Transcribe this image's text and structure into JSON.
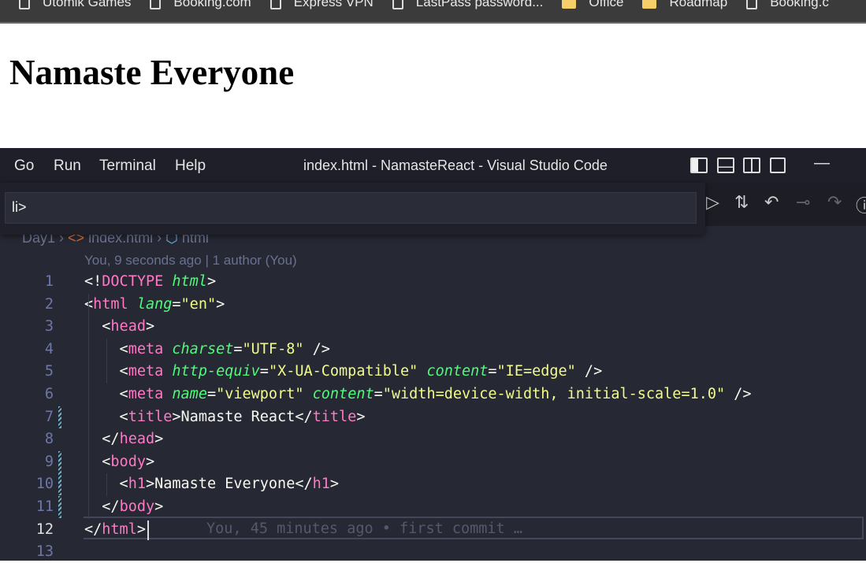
{
  "bookmarks": [
    {
      "label": "Utomik Games",
      "icon": "page-icon"
    },
    {
      "label": "Booking.com",
      "icon": "page-icon"
    },
    {
      "label": "Express VPN",
      "icon": "page-icon"
    },
    {
      "label": "LastPass password...",
      "icon": "page-icon"
    },
    {
      "label": "Office",
      "icon": "folder-icon"
    },
    {
      "label": "Roadmap",
      "icon": "folder-icon"
    },
    {
      "label": "Booking.c",
      "icon": "page-icon"
    }
  ],
  "page": {
    "heading": "Namaste Everyone"
  },
  "vscode": {
    "menu": [
      "Go",
      "Run",
      "Terminal",
      "Help"
    ],
    "window_title": "index.html - NamasteReact - Visual Studio Code",
    "quick_input": {
      "value": "li>"
    },
    "breadcrumb": [
      "Day1",
      "index.html",
      "html"
    ],
    "codelens": "You, 9 seconds ago | 1 author (You)",
    "blame": "You, 45 minutes ago • first commit …",
    "current_line": 12,
    "colors": {
      "tag": "#ff79c6",
      "attr": "#50fa7b",
      "string": "#f1fa8c",
      "text": "#f8f8f2",
      "bg": "#262833"
    },
    "lines": [
      [
        [
          "<!",
          "w"
        ],
        [
          "DOCTYPE",
          "p"
        ],
        [
          " ",
          "w"
        ],
        [
          "html",
          "g"
        ],
        [
          ">",
          "w"
        ]
      ],
      [
        [
          "<",
          "w"
        ],
        [
          "html",
          "p"
        ],
        [
          " ",
          "w"
        ],
        [
          "lang",
          "g"
        ],
        [
          "=",
          "w"
        ],
        [
          "\"en\"",
          "y"
        ],
        [
          ">",
          "w"
        ]
      ],
      [
        [
          "  <",
          "w"
        ],
        [
          "head",
          "p"
        ],
        [
          ">",
          "w"
        ]
      ],
      [
        [
          "    <",
          "w"
        ],
        [
          "meta",
          "p"
        ],
        [
          " ",
          "w"
        ],
        [
          "charset",
          "g"
        ],
        [
          "=",
          "w"
        ],
        [
          "\"UTF-8\"",
          "y"
        ],
        [
          " />",
          "w"
        ]
      ],
      [
        [
          "    <",
          "w"
        ],
        [
          "meta",
          "p"
        ],
        [
          " ",
          "w"
        ],
        [
          "http-equiv",
          "g"
        ],
        [
          "=",
          "w"
        ],
        [
          "\"X-UA-Compatible\"",
          "y"
        ],
        [
          " ",
          "w"
        ],
        [
          "content",
          "g"
        ],
        [
          "=",
          "w"
        ],
        [
          "\"IE=edge\"",
          "y"
        ],
        [
          " />",
          "w"
        ]
      ],
      [
        [
          "    <",
          "w"
        ],
        [
          "meta",
          "p"
        ],
        [
          " ",
          "w"
        ],
        [
          "name",
          "g"
        ],
        [
          "=",
          "w"
        ],
        [
          "\"viewport\"",
          "y"
        ],
        [
          " ",
          "w"
        ],
        [
          "content",
          "g"
        ],
        [
          "=",
          "w"
        ],
        [
          "\"width=device-width, initial-scale=1.0\"",
          "y"
        ],
        [
          " />",
          "w"
        ]
      ],
      [
        [
          "    <",
          "w"
        ],
        [
          "title",
          "p"
        ],
        [
          ">Namaste React</",
          "w"
        ],
        [
          "title",
          "p"
        ],
        [
          ">",
          "w"
        ]
      ],
      [
        [
          "  </",
          "w"
        ],
        [
          "head",
          "p"
        ],
        [
          ">",
          "w"
        ]
      ],
      [
        [
          "  <",
          "w"
        ],
        [
          "body",
          "p"
        ],
        [
          ">",
          "w"
        ]
      ],
      [
        [
          "    <",
          "w"
        ],
        [
          "h1",
          "p"
        ],
        [
          ">Namaste Everyone</",
          "w"
        ],
        [
          "h1",
          "p"
        ],
        [
          ">",
          "w"
        ]
      ],
      [
        [
          "  </",
          "w"
        ],
        [
          "body",
          "p"
        ],
        [
          ">",
          "w"
        ]
      ],
      [
        [
          "</",
          "w"
        ],
        [
          "html",
          "p"
        ],
        [
          ">",
          "w"
        ]
      ],
      []
    ],
    "modified_lines": [
      7,
      9,
      10,
      11
    ]
  }
}
